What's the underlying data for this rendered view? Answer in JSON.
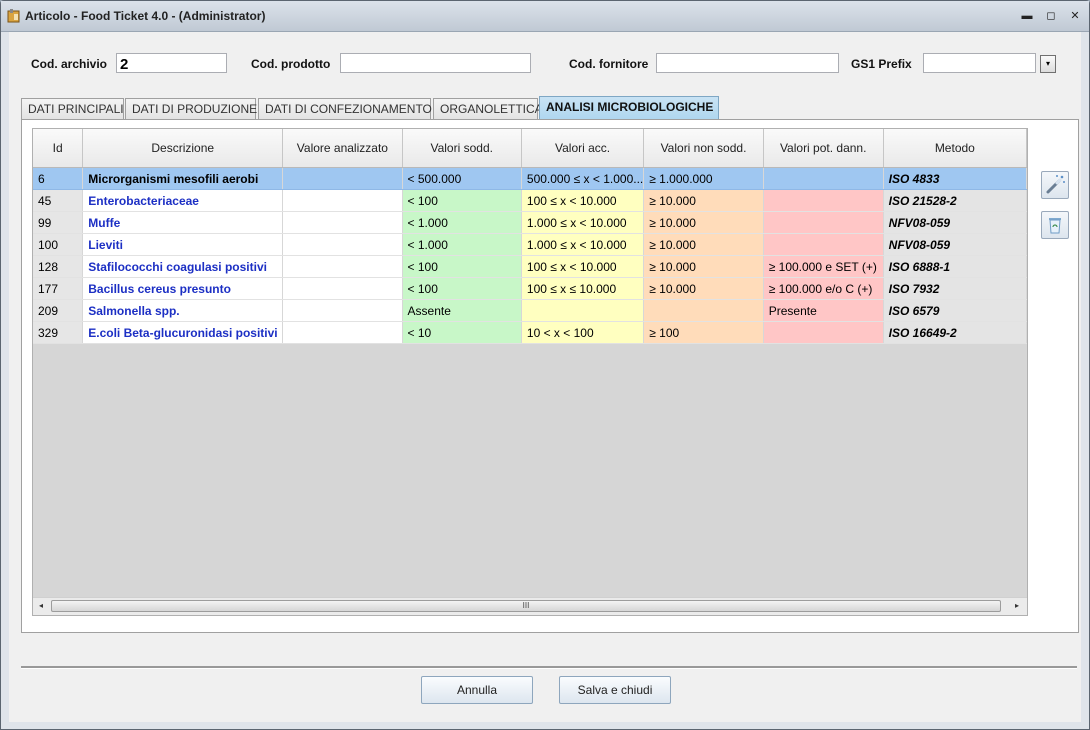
{
  "window": {
    "title": "Articolo - Food Ticket 4.0 - (Administrator)",
    "minimize": "▬",
    "maximize": "◻",
    "close": "✕"
  },
  "header": {
    "cod_archivio_label": "Cod. archivio",
    "cod_archivio_value": "2",
    "cod_prodotto_label": "Cod. prodotto",
    "cod_prodotto_value": "",
    "cod_fornitore_label": "Cod. fornitore",
    "cod_fornitore_value": "",
    "gs1_prefix_label": "GS1 Prefix",
    "gs1_prefix_value": ""
  },
  "tabs": [
    {
      "label": "DATI PRINCIPALI",
      "active": false
    },
    {
      "label": "DATI DI PRODUZIONE",
      "active": false
    },
    {
      "label": "DATI DI CONFEZIONAMENTO",
      "active": false
    },
    {
      "label": "ORGANOLETTICA",
      "active": false
    },
    {
      "label": "ANALISI MICROBIOLOGICHE",
      "active": true
    }
  ],
  "grid": {
    "columns": [
      "Id",
      "Descrizione",
      "Valore analizzato",
      "Valori sodd.",
      "Valori acc.",
      "Valori non sodd.",
      "Valori pot. dann.",
      "Metodo"
    ],
    "rows": [
      {
        "id": "6",
        "desc": "Microrganismi mesofili aerobi",
        "val": "",
        "sodd": "< 500.000",
        "acc": "500.000 ≤ x < 1.000...",
        "nonsodd": "≥ 1.000.000",
        "dann": "",
        "met": "ISO 4833",
        "selected": true
      },
      {
        "id": "45",
        "desc": "Enterobacteriaceae",
        "val": "",
        "sodd": "< 100",
        "acc": "100 ≤ x < 10.000",
        "nonsodd": "≥ 10.000",
        "dann": "",
        "met": "ISO 21528-2",
        "selected": false
      },
      {
        "id": "99",
        "desc": "Muffe",
        "val": "",
        "sodd": "< 1.000",
        "acc": "1.000 ≤ x < 10.000",
        "nonsodd": "≥ 10.000",
        "dann": "",
        "met": "NFV08-059",
        "selected": false
      },
      {
        "id": "100",
        "desc": "Lieviti",
        "val": "",
        "sodd": "< 1.000",
        "acc": "1.000 ≤ x < 10.000",
        "nonsodd": "≥ 10.000",
        "dann": "",
        "met": "NFV08-059",
        "selected": false
      },
      {
        "id": "128",
        "desc": "Stafilococchi coagulasi positivi",
        "val": "",
        "sodd": "< 100",
        "acc": "100 ≤ x < 10.000",
        "nonsodd": "≥ 10.000",
        "dann": "≥ 100.000 e SET (+)",
        "met": "ISO 6888-1",
        "selected": false
      },
      {
        "id": "177",
        "desc": "Bacillus cereus presunto",
        "val": "",
        "sodd": "< 100",
        "acc": "100 ≤ x ≤ 10.000",
        "nonsodd": "≥ 10.000",
        "dann": "≥ 100.000 e/o C (+)",
        "met": "ISO 7932",
        "selected": false
      },
      {
        "id": "209",
        "desc": "Salmonella spp.",
        "val": "",
        "sodd": "Assente",
        "acc": "",
        "nonsodd": "",
        "dann": "Presente",
        "met": "ISO 6579",
        "selected": false
      },
      {
        "id": "329",
        "desc": "E.coli Beta-glucuronidasi positivi",
        "val": "",
        "sodd": "< 10",
        "acc": "10 < x < 100",
        "nonsodd": "≥ 100",
        "dann": "",
        "met": "ISO 16649-2",
        "selected": false
      }
    ],
    "scroll_grip": "III",
    "scroll_left": "◂",
    "scroll_right": "▸"
  },
  "footer": {
    "annulla_label": "Annulla",
    "salva_label": "Salva e chiudi"
  },
  "icons": {
    "dropdown": "▾"
  }
}
